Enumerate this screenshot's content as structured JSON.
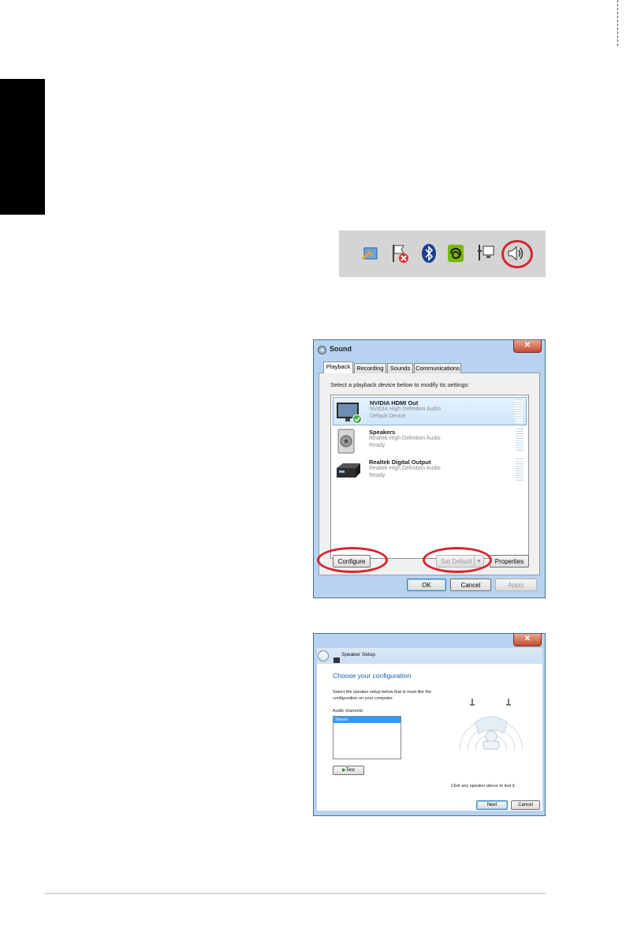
{
  "sound_dialog": {
    "title": "Sound",
    "tabs": [
      "Playback",
      "Recording",
      "Sounds",
      "Communications"
    ],
    "instruction": "Select a playback device below to modify its settings:",
    "devices": [
      {
        "name": "NVIDIA HDMI Out",
        "driver": "NVIDIA High Definition Audio",
        "status": "Default Device"
      },
      {
        "name": "Speakers",
        "driver": "Realtek High Definition Audio",
        "status": "Ready"
      },
      {
        "name": "Realtek Digital Output",
        "driver": "Realtek High Definition Audio",
        "status": "Ready"
      }
    ],
    "buttons": {
      "configure": "Configure",
      "set_default": "Set Default",
      "properties": "Properties",
      "ok": "OK",
      "cancel": "Cancel",
      "apply": "Apply"
    }
  },
  "speaker_setup": {
    "title": "Speaker Setup",
    "heading": "Choose your configuration",
    "description": "Select the speaker setup below that is most like the configuration on your computer.",
    "channels_label": "Audio channels:",
    "channels": [
      "Stereo"
    ],
    "test_label": "Test",
    "hint": "Click any speaker above to test it.",
    "next_label": "Next",
    "cancel_label": "Cancel"
  },
  "colors": {
    "highlight_ring": "#d9242f",
    "accent": "#1c5da8"
  }
}
